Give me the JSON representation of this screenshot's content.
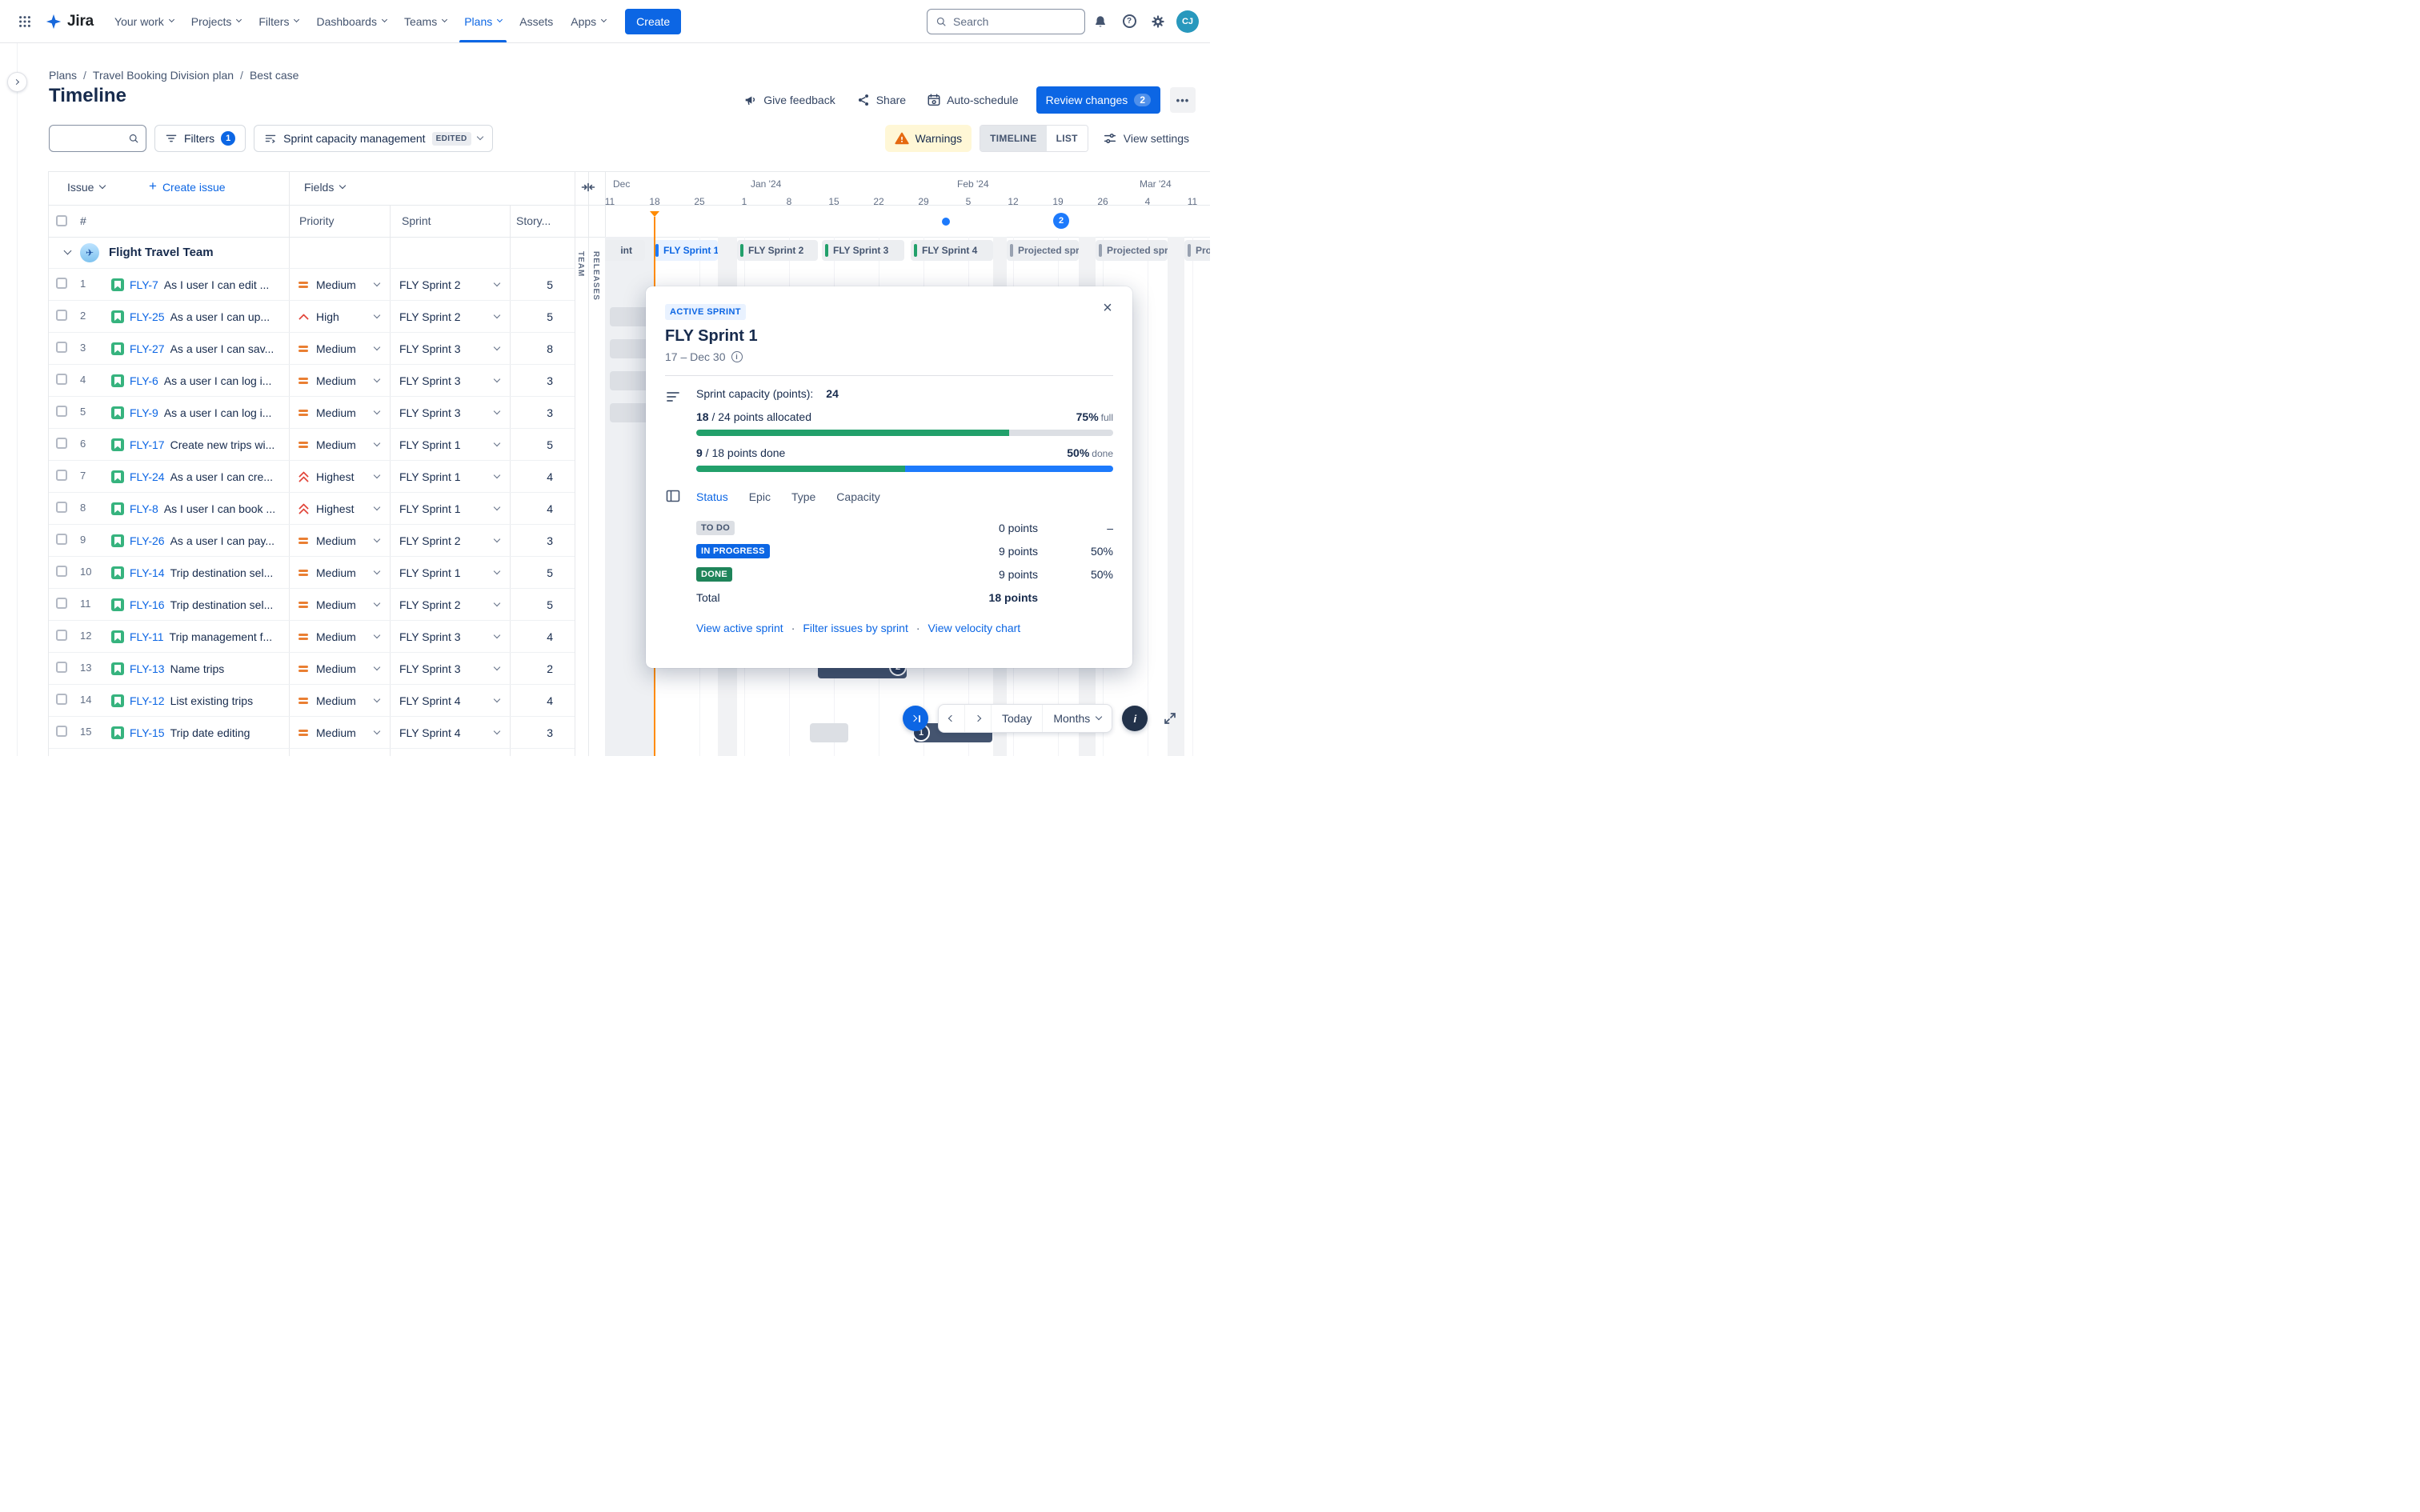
{
  "colors": {
    "brand": "#0C66E4",
    "success": "#22A06B",
    "warning": "#E56910",
    "today_marker": "#FF8B00",
    "bar_navy": "#44546F"
  },
  "navbar": {
    "logo_text": "Jira",
    "items": [
      {
        "label": "Your work",
        "caret": true
      },
      {
        "label": "Projects",
        "caret": true
      },
      {
        "label": "Filters",
        "caret": true
      },
      {
        "label": "Dashboards",
        "caret": true
      },
      {
        "label": "Teams",
        "caret": true
      },
      {
        "label": "Plans",
        "caret": true,
        "active": true
      },
      {
        "label": "Assets",
        "caret": false
      },
      {
        "label": "Apps",
        "caret": true
      }
    ],
    "create_label": "Create",
    "search_placeholder": "Search",
    "avatar_initials": "CJ"
  },
  "breadcrumb": [
    "Plans",
    "Travel Booking Division plan",
    "Best case"
  ],
  "page": {
    "title": "Timeline"
  },
  "actions": {
    "give_feedback": "Give feedback",
    "share": "Share",
    "auto_schedule": "Auto-schedule",
    "review_changes": "Review changes",
    "review_badge": "2",
    "more": "•••"
  },
  "toolbar": {
    "filters_label": "Filters",
    "filters_badge": "1",
    "view_name": "Sprint capacity management",
    "edited_badge": "EDITED",
    "warnings_label": "Warnings",
    "timeline_label": "TIMELINE",
    "list_label": "LIST",
    "view_settings_label": "View settings"
  },
  "table": {
    "issue_label": "Issue",
    "create_issue_label": "Create issue",
    "fields_label": "Fields",
    "columns": {
      "num": "#",
      "priority": "Priority",
      "sprint": "Sprint",
      "story_points": "Story..."
    },
    "group": {
      "name": "Flight Travel Team"
    },
    "rows": [
      {
        "num": "1",
        "key": "FLY-7",
        "summary": "As I user I can edit ...",
        "priority": "Medium",
        "sprint": "FLY Sprint 2",
        "points": "5"
      },
      {
        "num": "2",
        "key": "FLY-25",
        "summary": "As a user I can up...",
        "priority": "High",
        "sprint": "FLY Sprint 2",
        "points": "5"
      },
      {
        "num": "3",
        "key": "FLY-27",
        "summary": "As a user I can sav...",
        "priority": "Medium",
        "sprint": "FLY Sprint 3",
        "points": "8"
      },
      {
        "num": "4",
        "key": "FLY-6",
        "summary": "As a user I can log i...",
        "priority": "Medium",
        "sprint": "FLY Sprint 3",
        "points": "3"
      },
      {
        "num": "5",
        "key": "FLY-9",
        "summary": "As a user I can log i...",
        "priority": "Medium",
        "sprint": "FLY Sprint 3",
        "points": "3"
      },
      {
        "num": "6",
        "key": "FLY-17",
        "summary": "Create new trips wi...",
        "priority": "Medium",
        "sprint": "FLY Sprint 1",
        "points": "5"
      },
      {
        "num": "7",
        "key": "FLY-24",
        "summary": "As a user I can cre...",
        "priority": "Highest",
        "sprint": "FLY Sprint 1",
        "points": "4"
      },
      {
        "num": "8",
        "key": "FLY-8",
        "summary": "As I user I can book ...",
        "priority": "Highest",
        "sprint": "FLY Sprint 1",
        "points": "4"
      },
      {
        "num": "9",
        "key": "FLY-26",
        "summary": "As a user I can pay...",
        "priority": "Medium",
        "sprint": "FLY Sprint 2",
        "points": "3"
      },
      {
        "num": "10",
        "key": "FLY-14",
        "summary": "Trip destination sel...",
        "priority": "Medium",
        "sprint": "FLY Sprint 1",
        "points": "5"
      },
      {
        "num": "11",
        "key": "FLY-16",
        "summary": "Trip destination sel...",
        "priority": "Medium",
        "sprint": "FLY Sprint 2",
        "points": "5"
      },
      {
        "num": "12",
        "key": "FLY-11",
        "summary": "Trip management f...",
        "priority": "Medium",
        "sprint": "FLY Sprint 3",
        "points": "4"
      },
      {
        "num": "13",
        "key": "FLY-13",
        "summary": "Name trips",
        "priority": "Medium",
        "sprint": "FLY Sprint 3",
        "points": "2"
      },
      {
        "num": "14",
        "key": "FLY-12",
        "summary": "List existing trips",
        "priority": "Medium",
        "sprint": "FLY Sprint 4",
        "points": "4"
      },
      {
        "num": "15",
        "key": "FLY-15",
        "summary": "Trip date editing",
        "priority": "Medium",
        "sprint": "FLY Sprint 4",
        "points": "3"
      }
    ]
  },
  "timeline": {
    "vertical_labels": [
      "TEAM",
      "RELEASES"
    ],
    "months": [
      {
        "label": "Dec",
        "ticks": [
          "11",
          "18",
          "25"
        ]
      },
      {
        "label": "Jan '24",
        "ticks": [
          "1",
          "8",
          "15",
          "22",
          "29"
        ]
      },
      {
        "label": "Feb '24",
        "ticks": [
          "5",
          "12",
          "19",
          "26"
        ]
      },
      {
        "label": "Mar '24",
        "ticks": [
          "4",
          "11"
        ]
      }
    ],
    "sprints": [
      {
        "label": "int",
        "style": "cut"
      },
      {
        "label": "FLY Sprint 1",
        "style": "active"
      },
      {
        "label": "FLY Sprint 2",
        "style": "default"
      },
      {
        "label": "FLY Sprint 3",
        "style": "default"
      },
      {
        "label": "FLY Sprint 4",
        "style": "default"
      },
      {
        "label": "Projected spr...",
        "style": "projected"
      },
      {
        "label": "Projected spr...",
        "style": "projected"
      },
      {
        "label": "Proj...",
        "style": "projected"
      }
    ],
    "milestone_badge": "2",
    "bar_badges": {
      "row13": "2",
      "row15": "1"
    }
  },
  "popup": {
    "chip": "ACTIVE SPRINT",
    "title": "FLY Sprint 1",
    "dates": "17 – Dec 30",
    "capacity_label": "Sprint capacity (points):",
    "capacity_value": "24",
    "allocated_value": "18",
    "allocated_rest": " / 24 points allocated",
    "allocated_pct": "75%",
    "allocated_suffix": "full",
    "allocated_pct_num": 75,
    "done_value": "9",
    "done_rest": " / 18 points done",
    "done_pct": "50%",
    "done_suffix": "done",
    "done_pct_num": 50,
    "tabs": [
      {
        "label": "Status",
        "active": true
      },
      {
        "label": "Epic"
      },
      {
        "label": "Type"
      },
      {
        "label": "Capacity"
      }
    ],
    "status_rows": [
      {
        "label": "TO DO",
        "style": "todo",
        "points": "0 points",
        "pct": "–"
      },
      {
        "label": "IN PROGRESS",
        "style": "inprogress",
        "points": "9 points",
        "pct": "50%"
      },
      {
        "label": "DONE",
        "style": "done",
        "points": "9 points",
        "pct": "50%"
      }
    ],
    "total_label": "Total",
    "total_points": "18 points",
    "links": [
      "View active sprint",
      "Filter issues by sprint",
      "View velocity chart"
    ]
  },
  "bottom": {
    "today": "Today",
    "months": "Months"
  }
}
